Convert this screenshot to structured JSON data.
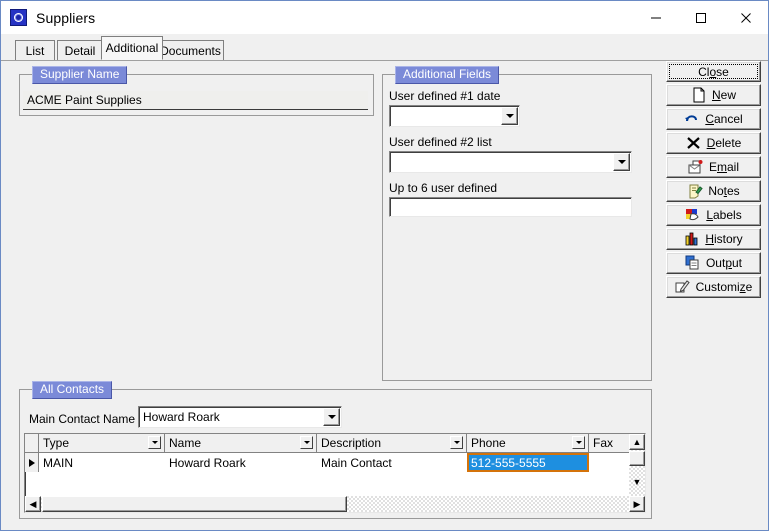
{
  "window": {
    "title": "Suppliers",
    "icon": "app-icon",
    "caption_buttons": [
      {
        "name": "minimize",
        "glyph": "minimize-icon"
      },
      {
        "name": "maximize",
        "glyph": "maximize-icon"
      },
      {
        "name": "close",
        "glyph": "close-icon"
      }
    ]
  },
  "tabs": [
    {
      "label": "List",
      "active": false
    },
    {
      "label": "Detail",
      "active": false
    },
    {
      "label": "Additional",
      "active": true
    },
    {
      "label": "Documents",
      "active": false
    }
  ],
  "supplier_group": {
    "legend": "Supplier Name",
    "name_value": "ACME Paint Supplies"
  },
  "additional_fields": {
    "legend": "Additional Fields",
    "date_label": "User defined #1 date",
    "date_value": "",
    "list_label": "User defined #2 list",
    "list_value": "",
    "text_label": "Up to 6 user defined",
    "text_value": ""
  },
  "contacts_group": {
    "legend": "All Contacts",
    "main_contact_label": "Main Contact Name",
    "main_contact_value": "Howard Roark",
    "columns": [
      "Type",
      "Name",
      "Description",
      "Phone",
      "Fax"
    ],
    "rows": [
      {
        "indicator": "current-row",
        "Type": "MAIN",
        "Name": "Howard Roark",
        "Description": "Main Contact",
        "Phone": "512-555-5555",
        "Fax": "",
        "selected_cell": "Phone"
      }
    ]
  },
  "buttons": [
    {
      "label": "Close",
      "mnemonic": "o",
      "icon": "none",
      "default": true
    },
    {
      "label": "New",
      "mnemonic": "N",
      "icon": "page-icon",
      "default": false
    },
    {
      "label": "Cancel",
      "mnemonic": "C",
      "icon": "undo-icon",
      "default": false
    },
    {
      "label": "Delete",
      "mnemonic": "D",
      "icon": "x-icon",
      "default": false
    },
    {
      "label": "Email",
      "mnemonic": "m",
      "icon": "envelope-icon",
      "default": false
    },
    {
      "label": "Notes",
      "mnemonic": "t",
      "icon": "note-icon",
      "default": false
    },
    {
      "label": "Labels",
      "mnemonic": "L",
      "icon": "labels-icon",
      "default": false
    },
    {
      "label": "History",
      "mnemonic": "H",
      "icon": "chart-icon",
      "default": false
    },
    {
      "label": "Output",
      "mnemonic": "p",
      "icon": "output-icon",
      "default": false
    },
    {
      "label": "Customize",
      "mnemonic": "z",
      "icon": "pencil-icon",
      "default": false
    }
  ],
  "colors": {
    "window_border": "#6a8ac4",
    "face": "#f0f0f0",
    "legend_bg": "#7b8ad8",
    "selection_bg": "#1e8fe0",
    "selection_border": "#d4730a"
  }
}
